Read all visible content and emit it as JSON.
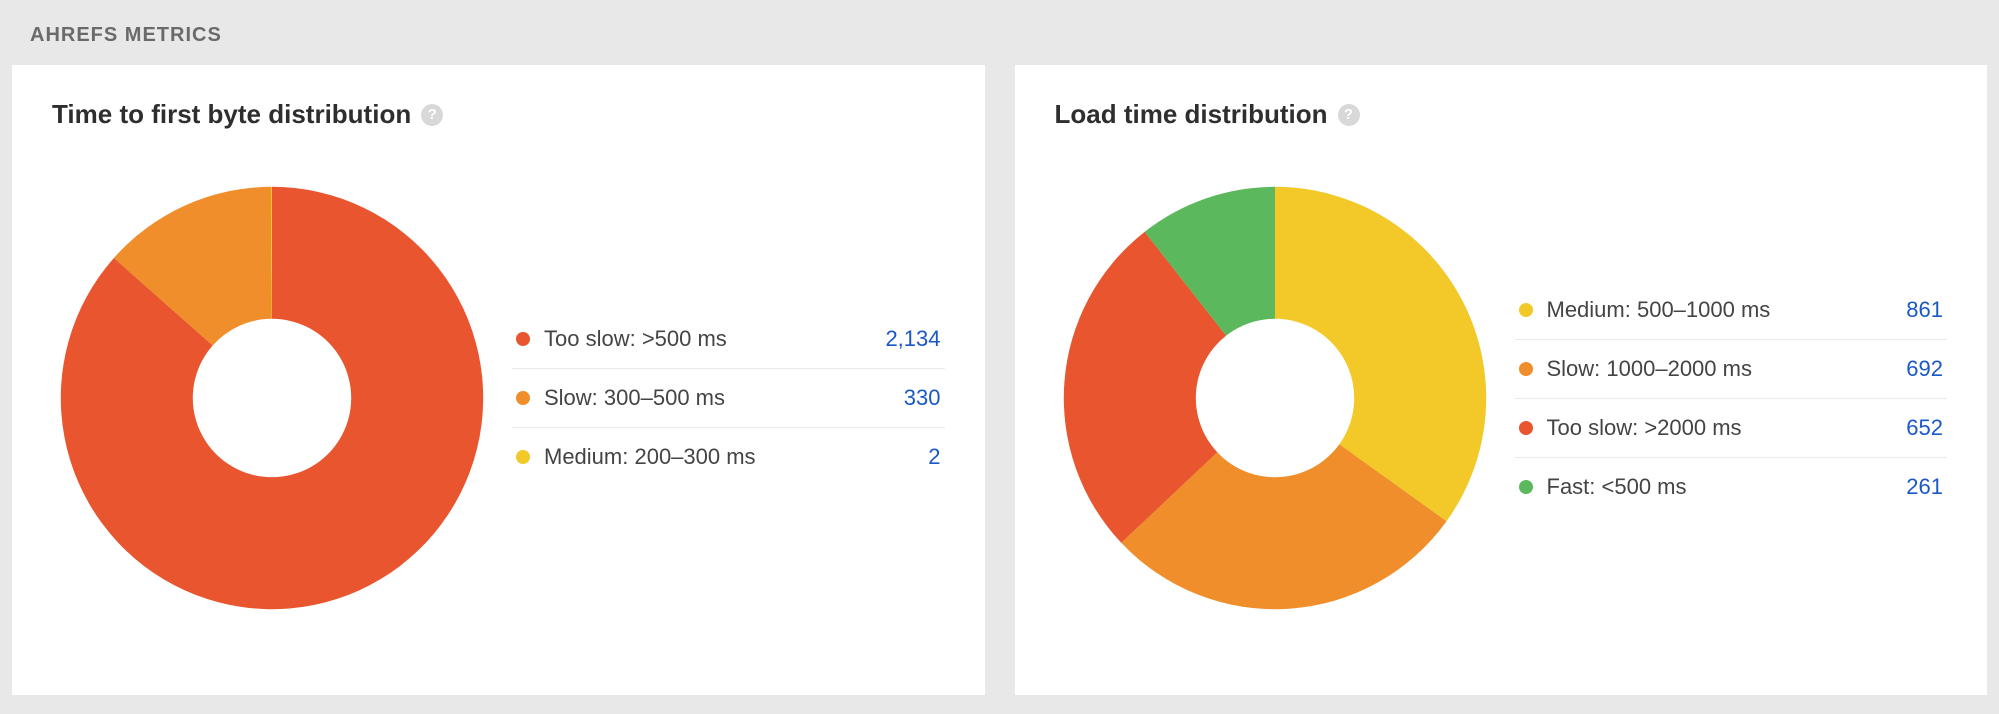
{
  "section_title": "AHREFS METRICS",
  "help_icon_glyph": "?",
  "colors": {
    "too_slow": "#e8552e",
    "slow": "#ef8e2a",
    "medium": "#f2c928",
    "fast": "#5cb85c",
    "link": "#1a58c7"
  },
  "cards": [
    {
      "title": "Time to first byte distribution"
    },
    {
      "title": "Load time distribution"
    }
  ],
  "chart_data": [
    {
      "type": "pie",
      "subtype": "donut",
      "title": "Time to first byte distribution",
      "series": [
        {
          "name": "Too slow: >500 ms",
          "value": 2134,
          "display_value": "2,134",
          "color_key": "too_slow"
        },
        {
          "name": "Slow: 300–500 ms",
          "value": 330,
          "display_value": "330",
          "color_key": "slow"
        },
        {
          "name": "Medium: 200–300 ms",
          "value": 2,
          "display_value": "2",
          "color_key": "medium"
        }
      ]
    },
    {
      "type": "pie",
      "subtype": "donut",
      "title": "Load time distribution",
      "series": [
        {
          "name": "Medium: 500–1000 ms",
          "value": 861,
          "display_value": "861",
          "color_key": "medium"
        },
        {
          "name": "Slow: 1000–2000 ms",
          "value": 692,
          "display_value": "692",
          "color_key": "slow"
        },
        {
          "name": "Too slow: >2000 ms",
          "value": 652,
          "display_value": "652",
          "color_key": "too_slow"
        },
        {
          "name": "Fast: <500 ms",
          "value": 261,
          "display_value": "261",
          "color_key": "fast"
        }
      ]
    }
  ]
}
